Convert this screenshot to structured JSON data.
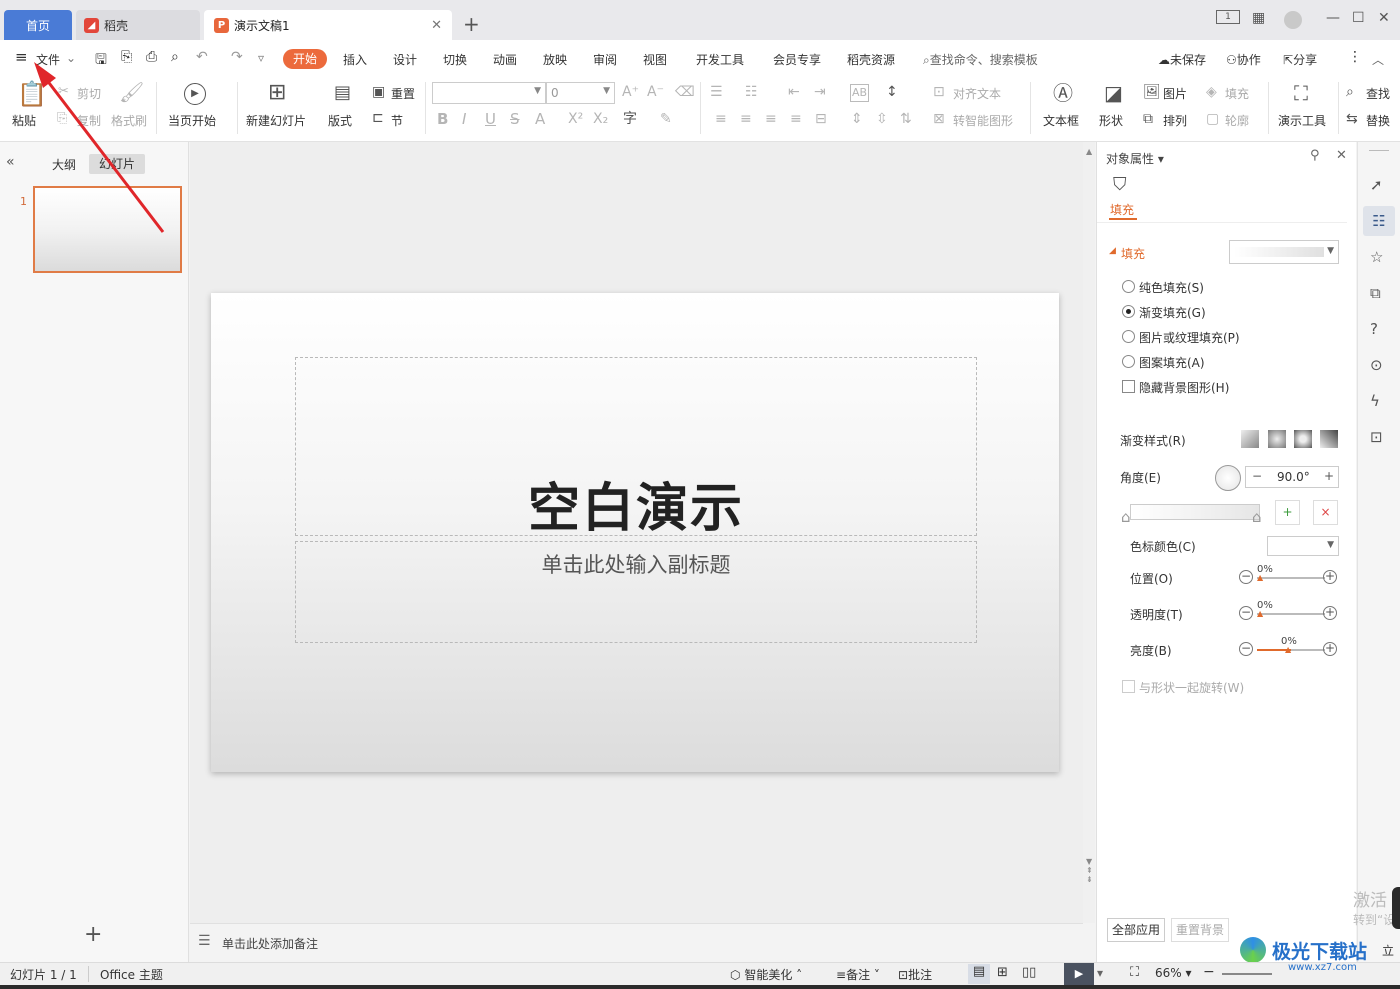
{
  "tabs": {
    "home": "首页",
    "daoke": "稻壳",
    "doc": "演示文稿1",
    "new_tab": "+"
  },
  "menu": {
    "file": "文件",
    "items": [
      "开始",
      "插入",
      "设计",
      "切换",
      "动画",
      "放映",
      "审阅",
      "视图",
      "开发工具",
      "会员专享",
      "稻壳资源"
    ],
    "search": "查找命令、搜索模板",
    "unsaved": "未保存",
    "collab": "协作",
    "share": "分享"
  },
  "ribbon": {
    "paste": "粘贴",
    "cut": "剪切",
    "copy": "复制",
    "format_painter": "格式刷",
    "play_from": "当页开始",
    "new_slide": "新建幻灯片",
    "layout": "版式",
    "reset": "重置",
    "section": "节",
    "font_size": "0",
    "align_text": "对齐文本",
    "smart_shape": "转智能图形",
    "textbox": "文本框",
    "shape": "形状",
    "picture": "图片",
    "arrange": "排列",
    "fill": "填充",
    "outline": "轮廓",
    "present_tools": "演示工具",
    "find": "查找",
    "replace": "替换"
  },
  "left": {
    "outline_tab": "大纲",
    "slides_tab": "幻灯片",
    "slide_number": "1",
    "add": "+"
  },
  "slide": {
    "title": "空白演示",
    "subtitle": "单击此处输入副标题"
  },
  "notes": {
    "placeholder": "单击此处添加备注"
  },
  "panel": {
    "title": "对象属性",
    "fill_tab": "填充",
    "section_fill": "填充",
    "options": [
      "纯色填充(S)",
      "渐变填充(G)",
      "图片或纹理填充(P)",
      "图案填充(A)"
    ],
    "selected_option": "渐变填充(G)",
    "hide_bg": "隐藏背景图形(H)",
    "gradient_style": "渐变样式(R)",
    "angle_label": "角度(E)",
    "angle_value": "90.0°",
    "stop_color": "色标颜色(C)",
    "position": "位置(O)",
    "position_value": "0%",
    "transparency": "透明度(T)",
    "transparency_value": "0%",
    "brightness": "亮度(B)",
    "brightness_value": "0%",
    "rotate_with_shape": "与形状一起旋转(W)",
    "apply_all": "全部应用",
    "reset_bg": "重置背景"
  },
  "status": {
    "slide_count": "幻灯片 1 / 1",
    "theme": "Office 主题",
    "beautify": "智能美化",
    "notes": "备注",
    "comments": "批注",
    "zoom": "66%"
  },
  "watermark": {
    "site": "极光下载站",
    "url": "www.xz7.com",
    "activate": "激活",
    "goto": "转到“设",
    "apply": "立即"
  },
  "colors": {
    "accent": "#ec6a3c",
    "home_tab": "#4a7bd6",
    "arrow": "#e0262a"
  }
}
